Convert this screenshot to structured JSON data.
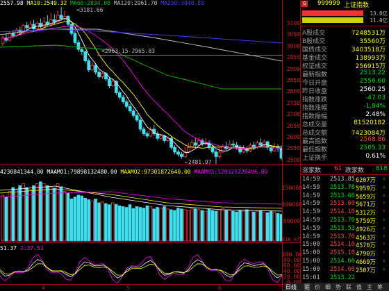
{
  "header": {
    "close_prefix": "2557.98",
    "ma10": "MA10:2549.32",
    "ma60": "MA60:2834.08",
    "ma120": "MA120:2961.70",
    "ma250": "MA250:3040.83"
  },
  "price_axis": [
    "3100",
    "3050",
    "3000",
    "2950",
    "2900",
    "2850",
    "2800",
    "2750",
    "2700",
    "2650",
    "2600",
    "2550",
    "2500"
  ],
  "annotations": {
    "high": "3181.66",
    "mid": "2963.15-2965.83",
    "low": "2481.97"
  },
  "volume_header": {
    "vol": "4230841344.00",
    "maamo1": "MAAMO1:79898132480.00",
    "maamo2": "MAAMO2:97301872640.00",
    "maamo3": "MAAMO3:120325226496.00"
  },
  "volume_axis": [
    "150000",
    "100000",
    "50000"
  ],
  "volume_unit": "X10.0万",
  "kdj_header": {
    "k": "51.37",
    "j": "J:37.51"
  },
  "kdj_axis": [
    "100.00",
    "80.00",
    "60.00",
    "40.00",
    "20.00",
    "0.00"
  ],
  "x_labels": [
    "4",
    "5",
    "6"
  ],
  "quote": {
    "code": "999999",
    "name": "上证指数",
    "scale_top": "13.0亿",
    "scale_bottom": "11.0亿",
    "rows": [
      {
        "k": "A股成交",
        "v": "7248531万",
        "c": "#ffff00"
      },
      {
        "k": "B股成交",
        "v": "35560万",
        "c": "#ffff00"
      },
      {
        "k": "国债成交",
        "v": "3403518万",
        "c": "#ffff00"
      },
      {
        "k": "基金成交",
        "v": "138993万",
        "c": "#ffff00"
      },
      {
        "k": "权证成交",
        "v": "256915万",
        "c": "#ffff00"
      },
      {
        "k": "最新指数",
        "v": "2513.22",
        "c": "#00e000"
      },
      {
        "k": "今日开盘",
        "v": "2556.60",
        "c": "#00e000"
      },
      {
        "k": "昨日收盘",
        "v": "2560.25",
        "c": "#ffffff"
      },
      {
        "k": "指数涨跌",
        "v": "-47.03",
        "c": "#00e000"
      },
      {
        "k": "指数涨幅",
        "v": "-1.84%",
        "c": "#00e000"
      },
      {
        "k": "指数振幅",
        "v": "2.48%",
        "c": "#ffffff"
      },
      {
        "k": "总成交量",
        "v": "81520182",
        "c": "#ffff00"
      },
      {
        "k": "总成交额",
        "v": "7423084万",
        "c": "#ffff00"
      },
      {
        "k": "最高指数",
        "v": "2568.86",
        "c": "#ff4040"
      },
      {
        "k": "最低指数",
        "v": "2505.33",
        "c": "#00e000"
      },
      {
        "k": "上证换手",
        "v": "0.61%",
        "c": "#ffffff"
      }
    ],
    "rise_label": "涨家数",
    "rise_count": "61",
    "fall_label": "跌家数",
    "fall_count": "818",
    "ticks": [
      {
        "t": "14:59",
        "p": "2513.85",
        "a": "6207万",
        "d": "↓"
      },
      {
        "t": "14:59",
        "p": "2513.78",
        "a": "5959万",
        "d": "↓"
      },
      {
        "t": "14:59",
        "p": "2513.66",
        "a": "5659万",
        "d": "↓"
      },
      {
        "t": "14:59",
        "p": "2513.69",
        "a": "5671万",
        "d": "↑"
      },
      {
        "t": "14:59",
        "p": "2514.10",
        "a": "5312万",
        "d": "↑"
      },
      {
        "t": "14:59",
        "p": "2513.70",
        "a": "5759万",
        "d": "↓"
      },
      {
        "t": "14:59",
        "p": "2513.53",
        "a": "4926万",
        "d": "↓"
      },
      {
        "t": "14:59",
        "p": "2513.70",
        "a": "4563万",
        "d": "↑"
      },
      {
        "t": "15:00",
        "p": "2514.10",
        "a": "4570万",
        "d": "↑"
      },
      {
        "t": "15:00",
        "p": "2515.10",
        "a": "4790万",
        "d": "↑"
      },
      {
        "t": "15:00",
        "p": "2514.60",
        "a": "4669万",
        "d": "↓"
      },
      {
        "t": "15:00",
        "p": "2514.60",
        "a": "2507万",
        "d": "↓"
      },
      {
        "t": "15:01",
        "p": "2513.22",
        "a": "",
        "d": ""
      }
    ]
  },
  "bottom_tabs": [
    "日线",
    "笔",
    "价",
    "细",
    "势",
    "联",
    "值",
    "主",
    "筹"
  ],
  "colors": {
    "up": "#ff4040",
    "down": "#40e0f0",
    "grid": "#b00000",
    "ma5": "#ffffff",
    "ma10": "#ffff00",
    "ma20": "#ff00ff",
    "ma60": "#00c000",
    "ma120": "#c0c0c0",
    "ma250": "#4040ff"
  }
}
